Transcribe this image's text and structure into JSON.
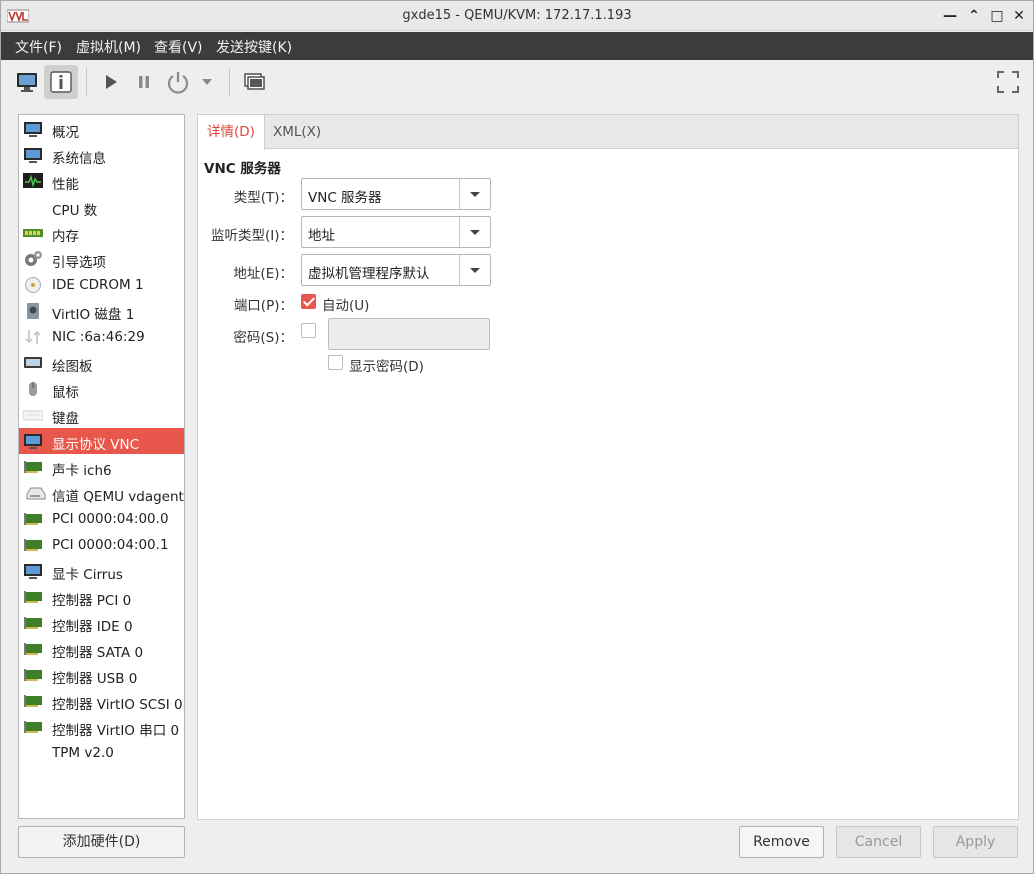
{
  "window": {
    "title": "gxde15 - QEMU/KVM: 172.17.1.193",
    "controls": {
      "minimize": "—",
      "restore": "⌃",
      "maximize": "□",
      "close": "✕"
    }
  },
  "menubar": [
    {
      "label": "文件(F)"
    },
    {
      "label": "虚拟机(M)"
    },
    {
      "label": "查看(V)"
    },
    {
      "label": "发送按键(K)"
    }
  ],
  "toolbar": {
    "icons": [
      "monitor-icon",
      "info-icon",
      "play-icon",
      "pause-icon",
      "power-icon",
      "dropdown-arrow-icon",
      "screenshot-icon",
      "fullscreen-icon"
    ],
    "active": "info-icon"
  },
  "hardware_list": [
    {
      "label": "概况",
      "icon": "monitor-icon"
    },
    {
      "label": "系统信息",
      "icon": "monitor-icon"
    },
    {
      "label": "性能",
      "icon": "performance-icon"
    },
    {
      "label": "CPU 数",
      "icon": "cpu-icon"
    },
    {
      "label": "内存",
      "icon": "memory-icon"
    },
    {
      "label": "引导选项",
      "icon": "gear-icon"
    },
    {
      "label": "IDE CDROM 1",
      "icon": "cdrom-icon"
    },
    {
      "label": "VirtIO 磁盘 1",
      "icon": "disk-icon"
    },
    {
      "label": "NIC :6a:46:29",
      "icon": "network-icon"
    },
    {
      "label": "绘图板",
      "icon": "tablet-icon"
    },
    {
      "label": "鼠标",
      "icon": "mouse-icon"
    },
    {
      "label": "键盘",
      "icon": "keyboard-icon"
    },
    {
      "label": "显示协议 VNC",
      "icon": "display-icon",
      "selected": true
    },
    {
      "label": "声卡 ich6",
      "icon": "card-icon"
    },
    {
      "label": "信道 QEMU vdagent",
      "icon": "channel-icon"
    },
    {
      "label": "PCI 0000:04:00.0",
      "icon": "card-icon"
    },
    {
      "label": "PCI 0000:04:00.1",
      "icon": "card-icon"
    },
    {
      "label": "显卡 Cirrus",
      "icon": "monitor-icon"
    },
    {
      "label": "控制器 PCI 0",
      "icon": "card-icon"
    },
    {
      "label": "控制器 IDE 0",
      "icon": "card-icon"
    },
    {
      "label": "控制器 SATA 0",
      "icon": "card-icon"
    },
    {
      "label": "控制器 USB 0",
      "icon": "card-icon"
    },
    {
      "label": "控制器 VirtIO SCSI 0",
      "icon": "card-icon"
    },
    {
      "label": "控制器 VirtIO 串口 0",
      "icon": "card-icon"
    },
    {
      "label": "TPM v2.0",
      "icon": ""
    }
  ],
  "add_hardware_label": "添加硬件(D)",
  "tabs": [
    {
      "label": "详情(D)",
      "active": true
    },
    {
      "label": "XML(X)",
      "active": false
    }
  ],
  "details": {
    "section_title": "VNC 服务器",
    "type": {
      "label": "类型(T)：",
      "value": "VNC 服务器"
    },
    "listen_type": {
      "label": "监听类型(I)：",
      "value": "地址"
    },
    "address": {
      "label": "地址(E)：",
      "value": "虚拟机管理程序默认"
    },
    "port": {
      "label": "端口(P)：",
      "auto_label": "自动(U)",
      "auto_checked": true
    },
    "password": {
      "label": "密码(S)：",
      "checked": false,
      "value": "",
      "show_label": "显示密码(D)",
      "show_checked": false
    }
  },
  "buttons": {
    "remove": "Remove",
    "cancel": "Cancel",
    "apply": "Apply"
  },
  "colors": {
    "accent": "#e8574c",
    "menubar_bg": "#3c3c3c"
  }
}
